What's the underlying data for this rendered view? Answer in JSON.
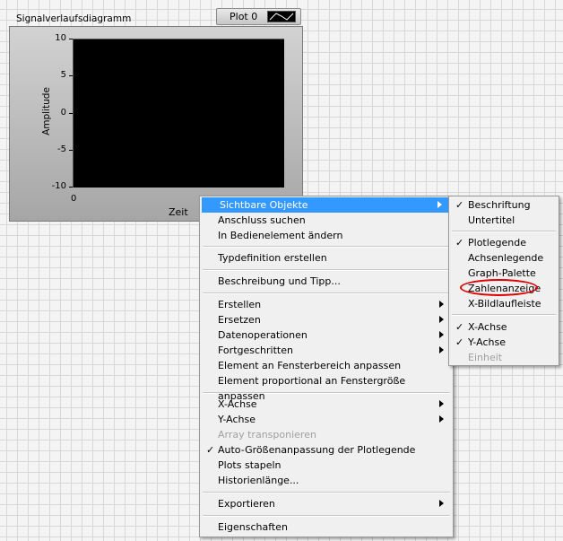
{
  "chart": {
    "label": "Signalverlaufsdiagramm",
    "legend_label": "Plot 0",
    "y_title": "Amplitude",
    "x_title": "Zeit",
    "y_ticks": [
      "10",
      "5",
      "0",
      "-5",
      "-10"
    ],
    "x_tick_0": "0"
  },
  "main_menu": {
    "items": [
      {
        "label": "Sichtbare Objekte",
        "submenu": true,
        "highlighted": true
      },
      {
        "label": "Anschluss suchen"
      },
      {
        "label": "In Bedienelement ändern"
      },
      {
        "label": "Typdefinition erstellen"
      },
      {
        "label": "Beschreibung und Tipp..."
      },
      {
        "label": "Erstellen",
        "submenu": true
      },
      {
        "label": "Ersetzen",
        "submenu": true
      },
      {
        "label": "Datenoperationen",
        "submenu": true
      },
      {
        "label": "Fortgeschritten",
        "submenu": true
      },
      {
        "label": "Element an Fensterbereich anpassen"
      },
      {
        "label": "Element proportional an Fenstergröße anpassen"
      },
      {
        "label": "X-Achse",
        "submenu": true
      },
      {
        "label": "Y-Achse",
        "submenu": true
      },
      {
        "label": "Array transponieren",
        "disabled": true
      },
      {
        "label": "Auto-Größenanpassung der Plotlegende",
        "checked": true
      },
      {
        "label": "Plots stapeln"
      },
      {
        "label": "Historienlänge..."
      },
      {
        "label": "Exportieren",
        "submenu": true
      },
      {
        "label": "Eigenschaften"
      }
    ]
  },
  "sub_menu": {
    "items": [
      {
        "label": "Beschriftung",
        "checked": true
      },
      {
        "label": "Untertitel"
      },
      {
        "label": "Plotlegende",
        "checked": true
      },
      {
        "label": "Achsenlegende"
      },
      {
        "label": "Graph-Palette"
      },
      {
        "label": "Zahlenanzeige",
        "circled": true
      },
      {
        "label": "X-Bildlaufleiste"
      },
      {
        "label": "X-Achse",
        "checked": true
      },
      {
        "label": "Y-Achse",
        "checked": true
      },
      {
        "label": "Einheit",
        "disabled": true
      }
    ]
  },
  "check_glyph": "✓",
  "colors": {
    "highlight": "#3399ff",
    "annotation": "#e00000"
  }
}
